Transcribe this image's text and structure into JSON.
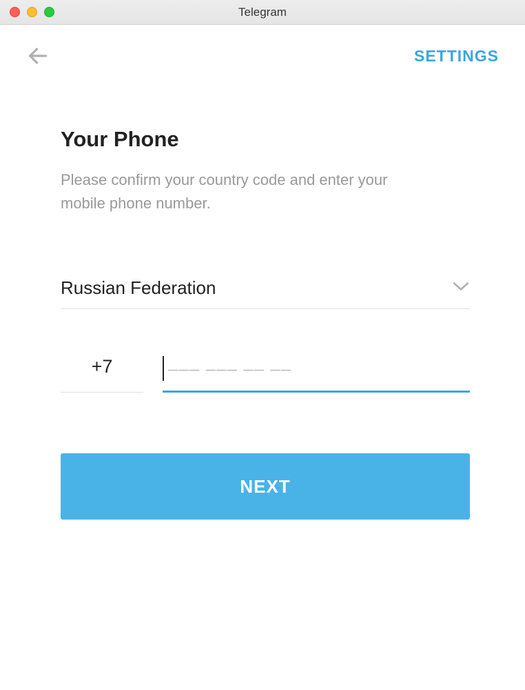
{
  "window": {
    "title": "Telegram"
  },
  "header": {
    "settings_label": "SETTINGS"
  },
  "main": {
    "title": "Your Phone",
    "subtitle": "Please confirm your country code and enter your mobile phone number.",
    "country": "Russian Federation",
    "country_code": "+7",
    "phone_placeholder": "––– ––– –– ––",
    "next_label": "NEXT"
  }
}
